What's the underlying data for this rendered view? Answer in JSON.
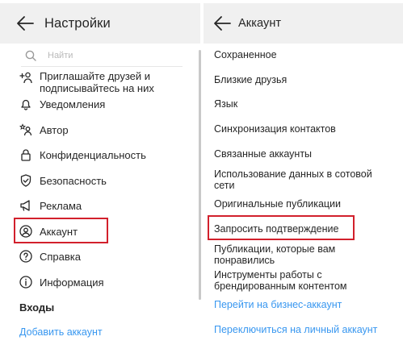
{
  "left": {
    "header": {
      "title": "Настройки"
    },
    "search": {
      "placeholder": "Найти"
    },
    "items": [
      {
        "label": "Приглашайте друзей и подписывайтесь на них",
        "icon": "add-person-icon"
      },
      {
        "label": "Уведомления",
        "icon": "bell-icon"
      },
      {
        "label": "Автор",
        "icon": "creator-stars-icon"
      },
      {
        "label": "Конфиденциальность",
        "icon": "lock-icon"
      },
      {
        "label": "Безопасность",
        "icon": "shield-check-icon"
      },
      {
        "label": "Реклама",
        "icon": "megaphone-icon"
      },
      {
        "label": "Аккаунт",
        "icon": "account-circle-icon",
        "highlighted": true
      },
      {
        "label": "Справка",
        "icon": "help-circle-icon"
      },
      {
        "label": "Информация",
        "icon": "info-circle-icon"
      }
    ],
    "logins_section": {
      "title": "Входы"
    },
    "add_account_link": "Добавить аккаунт"
  },
  "right": {
    "header": {
      "title": "Аккаунт"
    },
    "items": [
      {
        "label": "Сохраненное"
      },
      {
        "label": "Близкие друзья"
      },
      {
        "label": "Язык"
      },
      {
        "label": "Синхронизация контактов"
      },
      {
        "label": "Связанные аккаунты"
      },
      {
        "label": "Использование данных в сотовой сети"
      },
      {
        "label": "Оригинальные публикации"
      },
      {
        "label": "Запросить подтверждение",
        "highlighted": true
      },
      {
        "label": "Публикации, которые вам понравились"
      },
      {
        "label": "Инструменты работы с брендированным контентом"
      }
    ],
    "links": [
      "Перейти на бизнес-аккаунт",
      "Переключиться на личный аккаунт"
    ]
  },
  "colors": {
    "header_bg": "#f0f0f0",
    "text": "#262626",
    "link": "#3897f0",
    "highlight": "#d2202c",
    "placeholder": "#b9b9b9"
  }
}
